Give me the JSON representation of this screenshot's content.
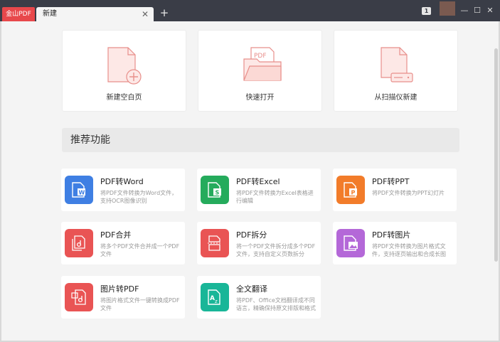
{
  "titlebar": {
    "app_tab": "金山PDF",
    "doc_tab": "新建",
    "close_glyph": "✕",
    "new_tab_glyph": "+",
    "badge": "1",
    "min_glyph": "—",
    "max_glyph": "☐",
    "close_win_glyph": "✕"
  },
  "quick_actions": [
    {
      "label": "新建空白页",
      "icon": "blank-page-plus-icon"
    },
    {
      "label": "快速打开",
      "icon": "open-folder-icon"
    },
    {
      "label": "从扫描仪新建",
      "icon": "scanner-page-icon"
    }
  ],
  "recommended": {
    "title": "推荐功能",
    "items": [
      {
        "title": "PDF转Word",
        "desc": "将PDF文件转换为Word文件，支持OCR图像识别",
        "color": "#3f7fe3",
        "icon": "word-icon"
      },
      {
        "title": "PDF转Excel",
        "desc": "将PDF文件转换为Excel表格进行编辑",
        "color": "#25ab5c",
        "icon": "excel-icon"
      },
      {
        "title": "PDF转PPT",
        "desc": "将PDF文件转换为PPT幻灯片",
        "color": "#f27c2a",
        "icon": "ppt-icon"
      },
      {
        "title": "PDF合并",
        "desc": "将多个PDF文件合并成一个PDF文件",
        "color": "#e95454",
        "icon": "merge-icon"
      },
      {
        "title": "PDF拆分",
        "desc": "将一个PDF文件拆分成多个PDF文件，支持自定义页数拆分",
        "color": "#e95454",
        "icon": "split-icon"
      },
      {
        "title": "PDF转图片",
        "desc": "将PDF文件转换为图片格式文件，支持逐页输出和合成长图",
        "color": "#b468d8",
        "icon": "image-icon"
      },
      {
        "title": "图片转PDF",
        "desc": "将图片格式文件一键转换成PDF文件",
        "color": "#e95454",
        "icon": "image-to-pdf-icon"
      },
      {
        "title": "全文翻译",
        "desc": "将PDF、Office文档翻译成不同语言，精确保持原文排版和格式",
        "color": "#19b698",
        "icon": "translate-icon"
      }
    ]
  }
}
